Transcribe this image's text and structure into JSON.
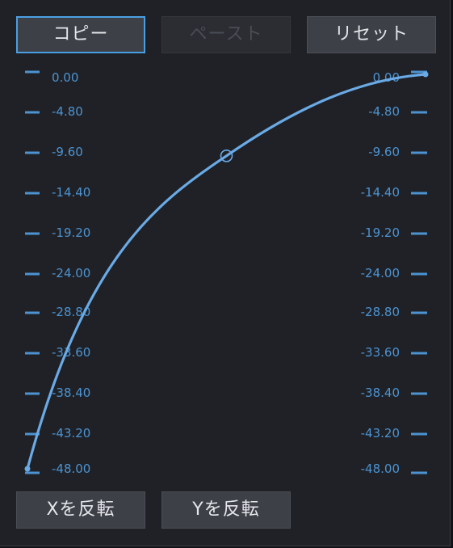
{
  "toolbar": {
    "copy_label": "コピー",
    "paste_label": "ペースト",
    "reset_label": "リセット"
  },
  "footer": {
    "flip_x_label": "Xを反転",
    "flip_y_label": "Yを反転"
  },
  "scale_left": [
    "0.00",
    "-4.80",
    "-9.60",
    "-14.40",
    "-19.20",
    "-24.00",
    "-28.80",
    "-33.60",
    "-38.40",
    "-43.20",
    "-48.00"
  ],
  "scale_right": [
    "0.00",
    "-4.80",
    "-9.60",
    "-14.40",
    "-19.20",
    "-24.00",
    "-28.80",
    "-33.60",
    "-38.40",
    "-43.20",
    "-48.00"
  ],
  "curve": {
    "start": [
      0,
      -48.0
    ],
    "control_point": [
      0.5,
      -9.6
    ],
    "end": [
      1,
      0.0
    ]
  },
  "colors": {
    "background": "#1f2126",
    "curve": "#6aaae6",
    "tick": "#4d93d1",
    "button": "#3d4047",
    "selected_border": "#4a9fe2"
  }
}
